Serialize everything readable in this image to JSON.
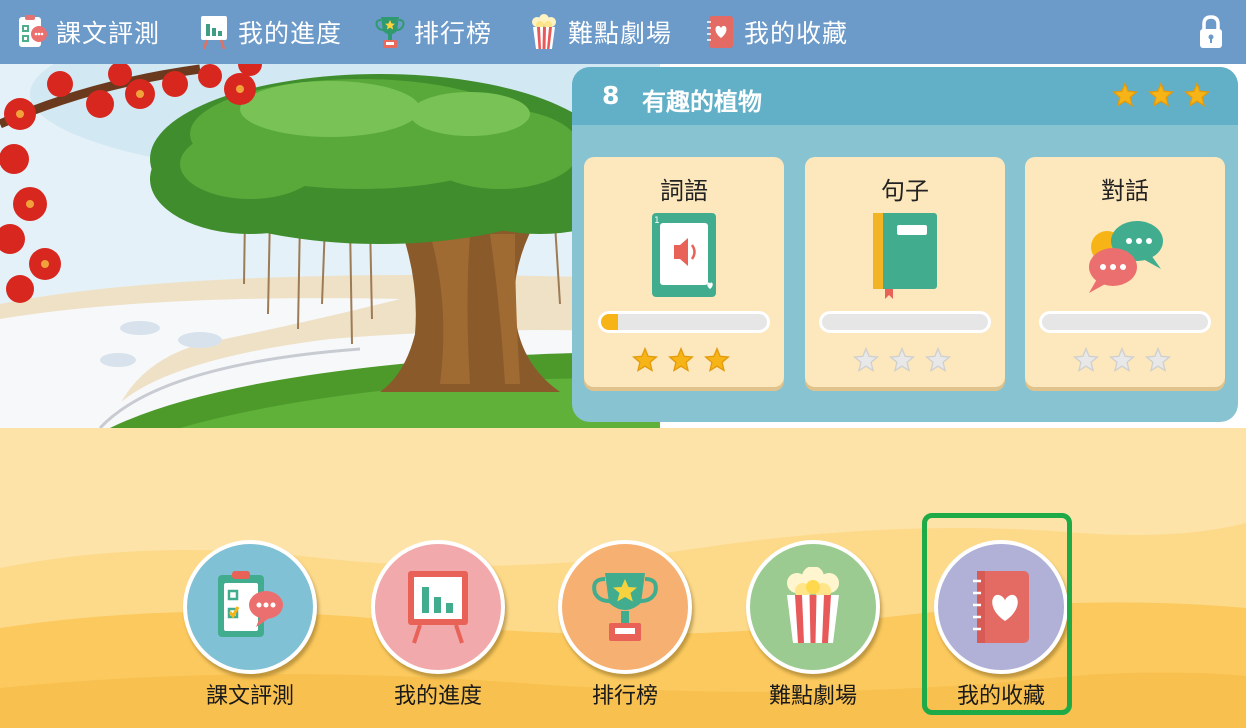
{
  "nav": {
    "items": [
      {
        "label": "課文評測",
        "icon": "clipboard-chat-icon"
      },
      {
        "label": "我的進度",
        "icon": "bar-chart-board-icon"
      },
      {
        "label": "排行榜",
        "icon": "trophy-icon"
      },
      {
        "label": "難點劇場",
        "icon": "popcorn-icon"
      },
      {
        "label": "我的收藏",
        "icon": "heart-notebook-icon"
      }
    ],
    "lock_icon": "lock-icon"
  },
  "lesson": {
    "number": "8",
    "title": "有趣的植物",
    "stars_earned": 3,
    "stars_total": 3,
    "cards": [
      {
        "title": "詞語",
        "icon": "sound-card-icon",
        "progress": 0.1,
        "stars_earned": 3,
        "stars_total": 3
      },
      {
        "title": "句子",
        "icon": "green-book-icon",
        "progress": 0,
        "stars_earned": 0,
        "stars_total": 3
      },
      {
        "title": "對話",
        "icon": "chat-bubbles-icon",
        "progress": 0,
        "stars_earned": 0,
        "stars_total": 3
      }
    ]
  },
  "menu": {
    "items": [
      {
        "label": "課文評測",
        "icon": "clipboard-chat-icon",
        "color": "#80c1d5"
      },
      {
        "label": "我的進度",
        "icon": "bar-chart-board-icon",
        "color": "#f1a9ab"
      },
      {
        "label": "排行榜",
        "icon": "trophy-icon",
        "color": "#f6b071"
      },
      {
        "label": "難點劇場",
        "icon": "popcorn-icon",
        "color": "#9ccb92"
      },
      {
        "label": "我的收藏",
        "icon": "heart-notebook-icon",
        "color": "#b1b1d8",
        "highlighted": true
      }
    ]
  },
  "colors": {
    "topbar": "#6c9ac9",
    "panel": "#88c3d1",
    "panel_header": "#62b0c8",
    "card": "#fde7bc",
    "star_gold": "#f6b417",
    "star_empty": "#e8e8e8",
    "highlight": "#1faa48"
  }
}
